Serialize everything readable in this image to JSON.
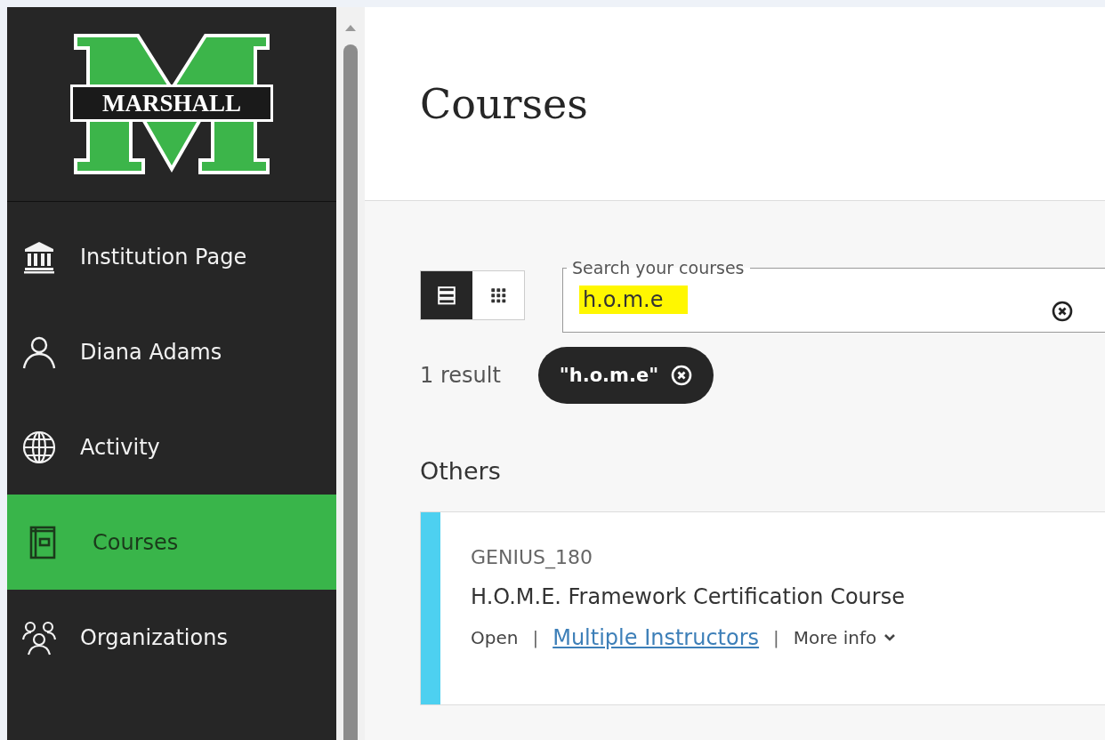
{
  "logo": {
    "wordmark": "MARSHALL"
  },
  "nav": [
    {
      "kind": "institution",
      "label": "Institution Page",
      "selected": false
    },
    {
      "kind": "person",
      "label": "Diana Adams",
      "selected": false
    },
    {
      "kind": "globe",
      "label": "Activity",
      "selected": false
    },
    {
      "kind": "courses",
      "label": "Courses",
      "selected": true
    },
    {
      "kind": "organizations",
      "label": "Organizations",
      "selected": false
    }
  ],
  "page_title": "Courses",
  "view_toggle": [
    {
      "kind": "list",
      "selected": true
    },
    {
      "kind": "grid",
      "selected": false
    }
  ],
  "search": {
    "label": "Search your courses",
    "value": "h.o.m.e",
    "highlighted": true
  },
  "results": {
    "count": "1 result",
    "filter_chip": "\"h.o.m.e\""
  },
  "section_heading": "Others",
  "courses": [
    {
      "code": "GENIUS_180",
      "title": "H.O.M.E. Framework Certification Course",
      "color": "#4dd0f0",
      "meta": [
        {
          "kind": "text",
          "text": "Open"
        },
        {
          "kind": "separator",
          "text": "|"
        },
        {
          "kind": "link",
          "text": "Multiple Instructors"
        },
        {
          "kind": "separator",
          "text": "|"
        },
        {
          "kind": "menu",
          "text": "More info"
        }
      ]
    }
  ]
}
